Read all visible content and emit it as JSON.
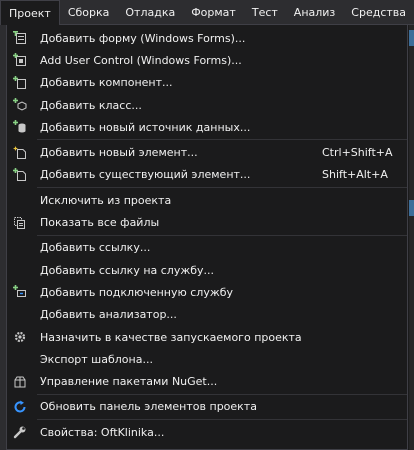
{
  "menubar": {
    "items": [
      {
        "label": "Проект",
        "active": true
      },
      {
        "label": "Сборка"
      },
      {
        "label": "Отладка"
      },
      {
        "label": "Формат"
      },
      {
        "label": "Тест"
      },
      {
        "label": "Анализ"
      },
      {
        "label": "Средства"
      }
    ]
  },
  "menu": {
    "items": [
      {
        "label": "Добавить форму (Windows Forms)...",
        "icon": "add-form-icon"
      },
      {
        "label": "Add User Control (Windows Forms)...",
        "icon": "add-user-control-icon"
      },
      {
        "label": "Добавить компонент...",
        "icon": "add-component-icon"
      },
      {
        "label": "Добавить класс...",
        "icon": "add-class-icon"
      },
      {
        "label": "Добавить новый источник данных...",
        "icon": "add-data-source-icon"
      },
      {
        "label": "Добавить новый элемент...",
        "icon": "add-new-item-icon",
        "shortcut": "Ctrl+Shift+A"
      },
      {
        "label": "Добавить существующий элемент...",
        "icon": "add-existing-item-icon",
        "shortcut": "Shift+Alt+A"
      },
      {
        "label": "Исключить из проекта"
      },
      {
        "label": "Показать все файлы",
        "icon": "show-all-files-icon"
      },
      {
        "label": "Добавить ссылку..."
      },
      {
        "label": "Добавить ссылку на службу..."
      },
      {
        "label": "Добавить подключенную службу",
        "icon": "connected-service-icon"
      },
      {
        "label": "Добавить анализатор..."
      },
      {
        "label": "Назначить в качестве запускаемого проекта",
        "icon": "gear-icon"
      },
      {
        "label": "Экспорт шаблона..."
      },
      {
        "label": "Управление пакетами NuGet...",
        "icon": "nuget-icon"
      },
      {
        "label": "Обновить панель элементов проекта",
        "icon": "refresh-icon"
      },
      {
        "label": "Свойства: OftKlinika...",
        "icon": "wrench-icon"
      }
    ]
  },
  "colors": {
    "menu_bg": "#1b1b1c",
    "menubar_bg": "#2d2d30",
    "text": "#f1f1f1",
    "icon_green": "#89d185",
    "icon_blue": "#3794ff"
  }
}
